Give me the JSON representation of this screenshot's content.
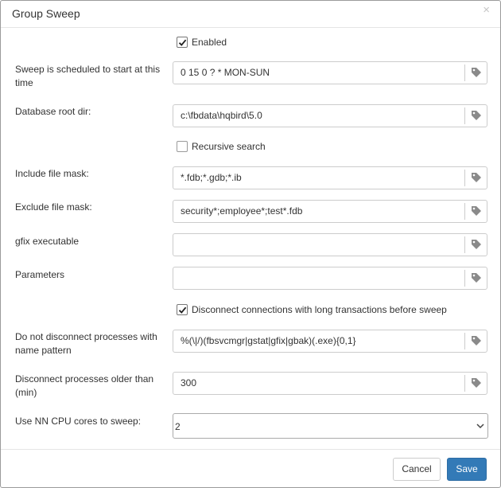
{
  "dialog": {
    "title": "Group Sweep",
    "close_glyph": "×"
  },
  "enabled": {
    "label": "Enabled",
    "checked": true
  },
  "schedule": {
    "label": "Sweep is scheduled to start at this time",
    "value": "0 15 0 ? * MON-SUN"
  },
  "root_dir": {
    "label": "Database root dir:",
    "value": "c:\\fbdata\\hqbird\\5.0"
  },
  "recursive": {
    "label": "Recursive search",
    "checked": false
  },
  "include_mask": {
    "label": "Include file mask:",
    "value": "*.fdb;*.gdb;*.ib"
  },
  "exclude_mask": {
    "label": "Exclude file mask:",
    "value": "security*;employee*;test*.fdb"
  },
  "gfix": {
    "label": "gfix executable",
    "value": ""
  },
  "parameters": {
    "label": "Parameters",
    "value": ""
  },
  "disconnect_long": {
    "label": "Disconnect connections with long transactions before sweep",
    "checked": true
  },
  "no_disconnect_pattern": {
    "label": "Do not disconnect processes with name pattern",
    "value": "%(\\|/)(fbsvcmgr|gstat|gfix|gbak)(.exe){0,1}"
  },
  "older_than": {
    "label": "Disconnect processes older than (min)",
    "value": "300"
  },
  "cpu_cores": {
    "label": "Use NN CPU cores to sweep:",
    "value": "2"
  },
  "buttons": {
    "cancel": "Cancel",
    "save": "Save"
  },
  "icons": {
    "addon": "tag-icon",
    "select": "chevron-down-icon"
  }
}
